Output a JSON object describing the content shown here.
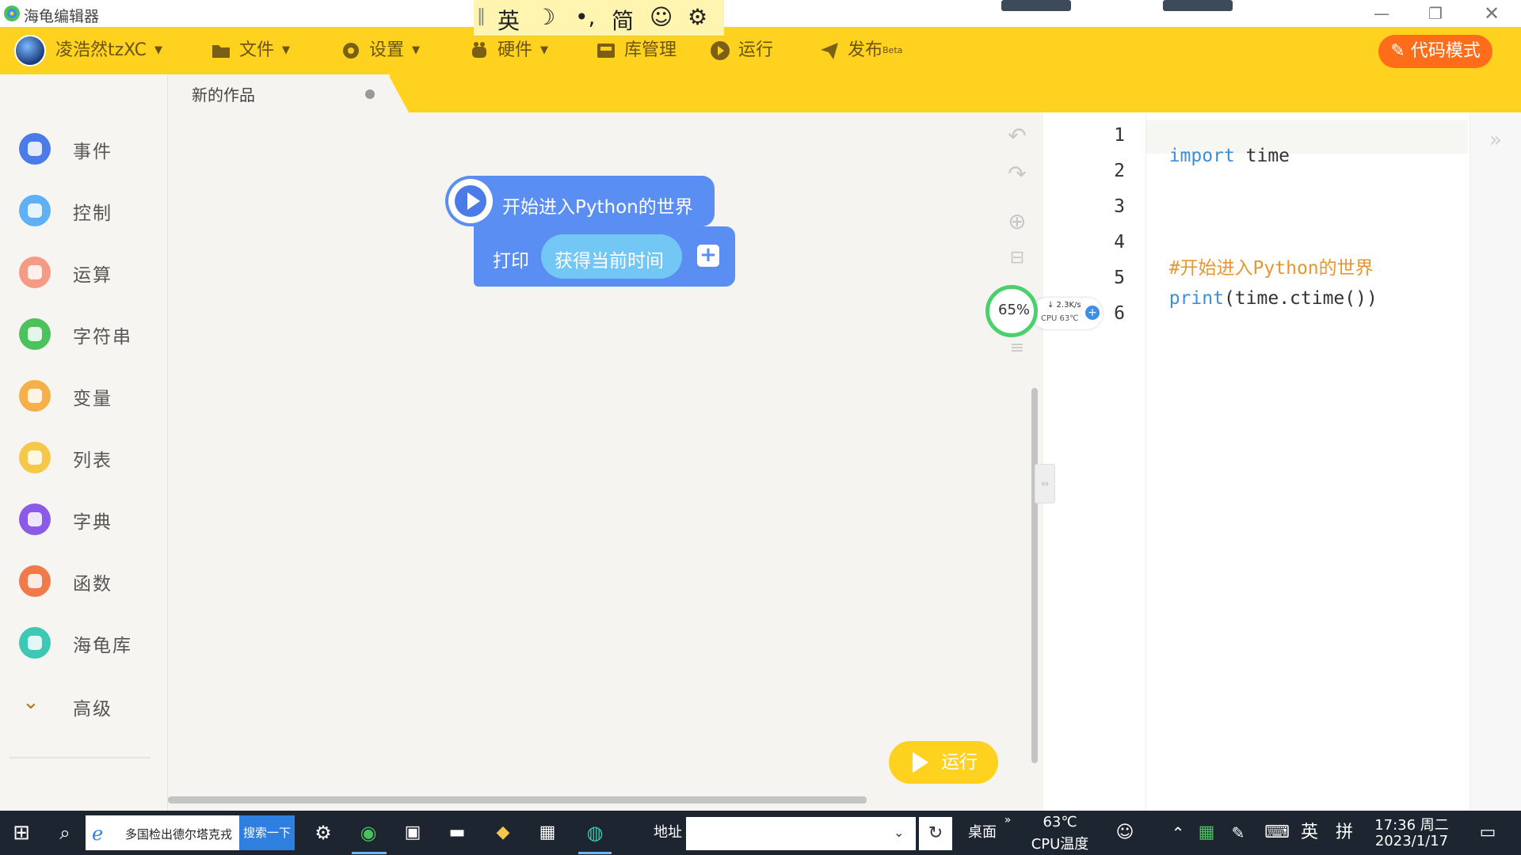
{
  "window": {
    "title": "海龟编辑器",
    "controls": {
      "minimize": "—",
      "restore": "❐",
      "close": "✕"
    }
  },
  "ime_toolbar": [
    "英",
    "☽",
    "•,",
    "简",
    "☺",
    "⚙"
  ],
  "toolbar": {
    "username": "凌浩然tzXC",
    "file": "文件",
    "settings": "设置",
    "hardware": "硬件",
    "library": "库管理",
    "run": "运行",
    "publish": "发布",
    "publish_badge": "Beta",
    "code_mode": "代码模式"
  },
  "tab": {
    "label": "新的作品"
  },
  "sidebar": {
    "items": [
      {
        "label": "事件",
        "color": "#4a7be8",
        "icon": "event-icon"
      },
      {
        "label": "控制",
        "color": "#5fb0f5",
        "icon": "control-icon"
      },
      {
        "label": "运算",
        "color": "#f59a84",
        "icon": "operator-icon"
      },
      {
        "label": "字符串",
        "color": "#4cc25c",
        "icon": "string-icon"
      },
      {
        "label": "变量",
        "color": "#f5b04a",
        "icon": "variable-icon"
      },
      {
        "label": "列表",
        "color": "#f5c84a",
        "icon": "list-icon"
      },
      {
        "label": "字典",
        "color": "#8a5ae8",
        "icon": "dict-icon"
      },
      {
        "label": "函数",
        "color": "#f07a4a",
        "icon": "function-icon"
      },
      {
        "label": "海龟库",
        "color": "#3cc8b4",
        "icon": "turtle-icon"
      }
    ],
    "advanced": "高级"
  },
  "blocks": {
    "hat": "开始进入Python的世界",
    "print": "打印",
    "reporter": "获得当前时间",
    "add": "+"
  },
  "workspace": {
    "run_button": "运行"
  },
  "perf_widget": {
    "percent": "65%",
    "speed": "↓ 2.3K/s",
    "cpu_label": "CPU 63℃"
  },
  "editor": {
    "line_numbers": [
      "1",
      "2",
      "3",
      "4",
      "5",
      "6"
    ],
    "lines": [
      {
        "parts": [
          {
            "text": "import",
            "color": "#3b8fd9"
          },
          {
            "text": " time",
            "color": "#333333"
          }
        ]
      },
      {
        "parts": []
      },
      {
        "parts": []
      },
      {
        "parts": [
          {
            "text": "#开始进入Python的世界",
            "color": "#e8962e"
          }
        ]
      },
      {
        "parts": [
          {
            "text": "print",
            "color": "#3b8fd9"
          },
          {
            "text": "(time.ctime())",
            "color": "#333333"
          }
        ]
      },
      {
        "parts": []
      }
    ]
  },
  "taskbar": {
    "search_text": "多国检出德尔塔克戎",
    "search_button": "搜索一下",
    "address_label": "地址",
    "address_value": "",
    "desktop": "桌面",
    "temperature": "63℃",
    "temperature_label": "CPU温度",
    "ime_lang": "英",
    "ime_mode": "拼",
    "time": "17:36 周二",
    "date": "2023/1/17"
  }
}
